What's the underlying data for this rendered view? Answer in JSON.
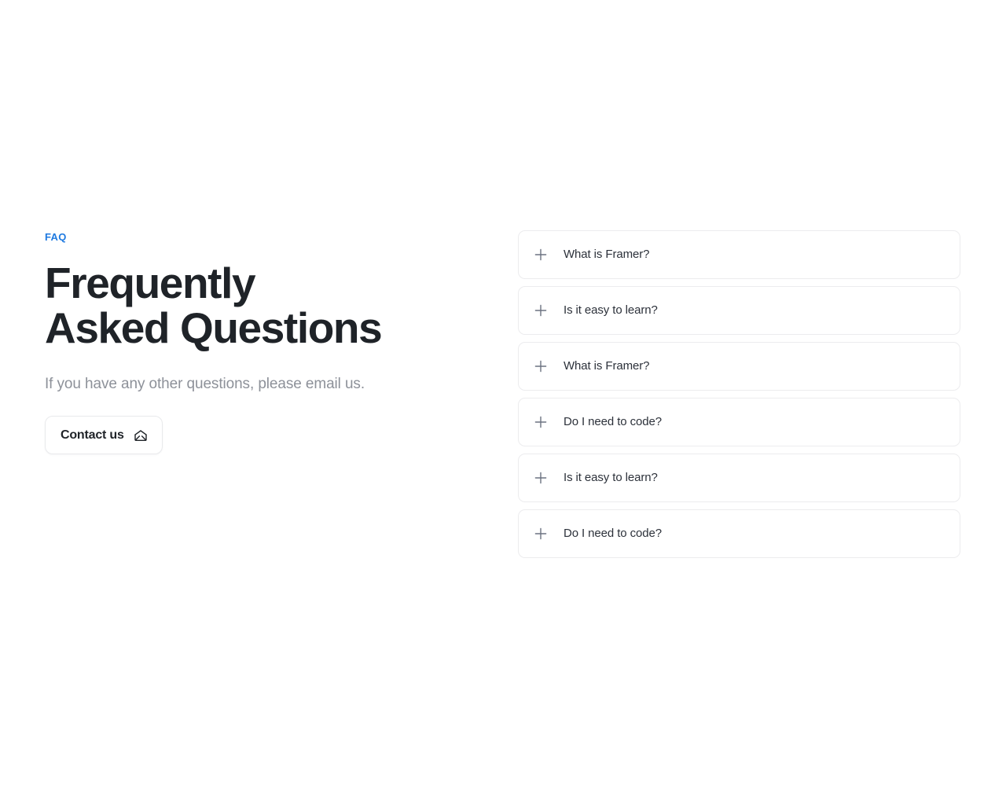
{
  "theme": {
    "background": "#ffffff",
    "accent_blue": "#1f7ae0",
    "heading_color": "#1f2328",
    "muted_text": "#8d9199",
    "card_border": "#ececee",
    "icon_gray": "#6b7280"
  },
  "intro": {
    "eyebrow": "FAQ",
    "headline": "Frequently Asked Questions",
    "subtitle": "If you have any other questions, please email us.",
    "contact_button": {
      "label": "Contact us",
      "icon": "open-envelope-icon"
    }
  },
  "accordion": {
    "expand_icon": "plus-icon",
    "items": [
      {
        "question": "What is Framer?"
      },
      {
        "question": "Is it easy to learn?"
      },
      {
        "question": "What is Framer?"
      },
      {
        "question": "Do I need to code?"
      },
      {
        "question": "Is it easy to learn?"
      },
      {
        "question": "Do I need to code?"
      }
    ]
  }
}
